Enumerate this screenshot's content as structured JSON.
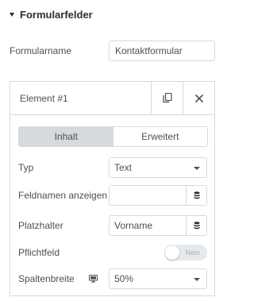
{
  "section": {
    "title": "Formularfelder",
    "collapse_icon": "caret-down-icon"
  },
  "form_name": {
    "label": "Formularname",
    "value": "Kontaktformular"
  },
  "repeater_item": {
    "title": "Element #1",
    "duplicate_icon": "copy-icon",
    "remove_icon": "close-icon",
    "tabs": [
      {
        "label": "Inhalt",
        "active": true
      },
      {
        "label": "Erweitert",
        "active": false
      }
    ],
    "type": {
      "label": "Typ",
      "value": "Text"
    },
    "show_field_name": {
      "label": "Feldnamen anzeigen",
      "value": "",
      "icon": "database-icon"
    },
    "placeholder": {
      "label": "Platzhalter",
      "value": "Vorname",
      "icon": "database-icon"
    },
    "required": {
      "label": "Pflichtfeld",
      "state_label": "Nein",
      "on": false
    },
    "column_width": {
      "label": "Spaltenbreite",
      "device_icon": "desktop-monitor-icon",
      "value": "50%"
    }
  },
  "colors": {
    "border": "#d5dadf",
    "active_tab": "#d5dadf",
    "text": "#495157",
    "heading": "#2b2e33"
  }
}
